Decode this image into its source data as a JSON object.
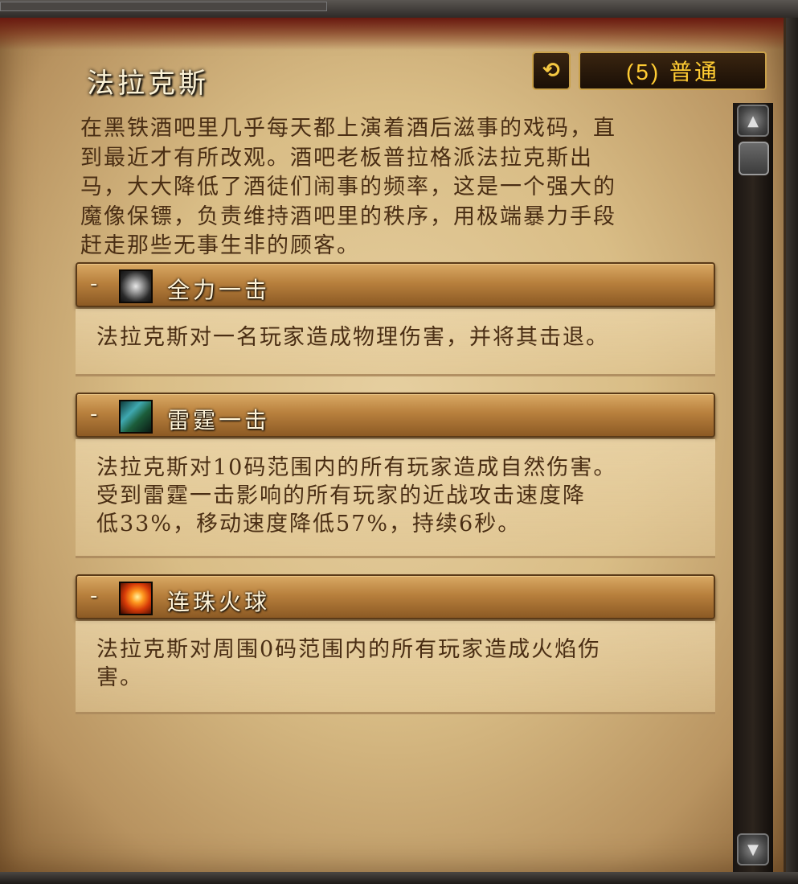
{
  "encounter": {
    "title": "法拉克斯",
    "reset_icon": "refresh-icon",
    "difficulty": "(5) 普通",
    "description_lines": [
      "在黑铁酒吧里几乎每天都上演着酒后滋事的戏码，直",
      "到最近才有所改观。酒吧老板普拉格派法拉克斯出",
      "马，大大降低了酒徒们闹事的频率，这是一个强大的",
      "魔像保镖，负责维持酒吧里的秩序，用极端暴力手段",
      "赶走那些无事生非的顾客。"
    ]
  },
  "abilities": [
    {
      "toggle": "-",
      "icon": "gear-fist-icon",
      "name": "全力一击",
      "description_lines": [
        "法拉克斯对一名玩家造成物理伤害，并将其击退。"
      ]
    },
    {
      "toggle": "-",
      "icon": "thunderclap-icon",
      "name": "雷霆一击",
      "description_lines": [
        "法拉克斯对10码范围内的所有玩家造成自然伤害。",
        "受到雷霆一击影响的所有玩家的近战攻击速度降",
        "低33%，移动速度降低57%，持续6秒。"
      ]
    },
    {
      "toggle": "-",
      "icon": "fireball-icon",
      "name": "连珠火球",
      "description_lines": [
        "法拉克斯对周围0码范围内的所有玩家造成火焰伤",
        "害。"
      ]
    }
  ],
  "scrollbar": {
    "up_icon": "scroll-up-icon",
    "down_icon": "scroll-down-icon"
  }
}
